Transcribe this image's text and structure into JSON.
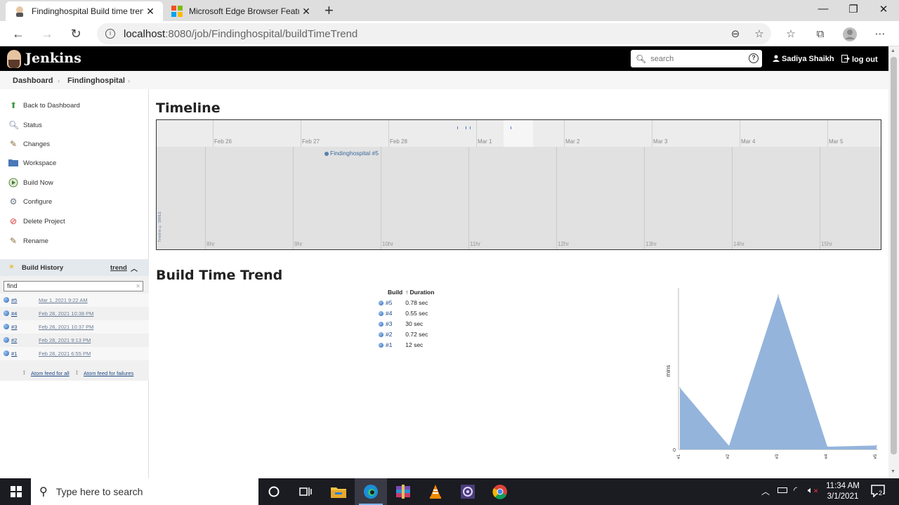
{
  "browser": {
    "tabs": [
      {
        "title": "Findinghospital Build time trend",
        "active": true
      },
      {
        "title": "Microsoft Edge Browser Features",
        "active": false
      }
    ],
    "url_host": "localhost",
    "url_rest": ":8080/job/Findinghospital/buildTimeTrend"
  },
  "jenkins": {
    "title": "Jenkins",
    "search_placeholder": "search",
    "user": "Sadiya Shaikh",
    "logout": "log out"
  },
  "breadcrumb": [
    "Dashboard",
    "Findinghospital"
  ],
  "sidebar": {
    "tasks": [
      {
        "label": "Back to Dashboard",
        "icon": "up-arrow-icon"
      },
      {
        "label": "Status",
        "icon": "magnifier-icon"
      },
      {
        "label": "Changes",
        "icon": "notepad-icon"
      },
      {
        "label": "Workspace",
        "icon": "folder-icon"
      },
      {
        "label": "Build Now",
        "icon": "clock-play-icon"
      },
      {
        "label": "Configure",
        "icon": "gear-icon"
      },
      {
        "label": "Delete Project",
        "icon": "no-entry-icon"
      },
      {
        "label": "Rename",
        "icon": "notepad-icon"
      }
    ],
    "build_history": {
      "title": "Build History",
      "trend_link": "trend",
      "find_value": "find",
      "builds": [
        {
          "num": "#5",
          "date": "Mar 1, 2021 9:22 AM"
        },
        {
          "num": "#4",
          "date": "Feb 28, 2021 10:38 PM"
        },
        {
          "num": "#3",
          "date": "Feb 28, 2021 10:37 PM"
        },
        {
          "num": "#2",
          "date": "Feb 28, 2021 9:13 PM"
        },
        {
          "num": "#1",
          "date": "Feb 28, 2021 6:55 PM"
        }
      ],
      "feed_all": "Atom feed for all",
      "feed_failures": "Atom feed for failures"
    }
  },
  "timeline": {
    "heading": "Timeline",
    "days": [
      "Feb 26",
      "Feb 27",
      "Feb 28",
      "Mar 1",
      "Mar 2",
      "Mar 3",
      "Mar 4",
      "Mar 5"
    ],
    "hours": [
      "8hr",
      "9hr",
      "10hr",
      "11hr",
      "12hr",
      "13hr",
      "14hr",
      "15hr"
    ],
    "event": "Findinghospital #5",
    "credit": "Timeline © SIMILE"
  },
  "trend": {
    "heading": "Build Time Trend",
    "col_build": "Build",
    "col_duration": "Duration",
    "sort_arrow": "↑",
    "rows": [
      {
        "build": "#5",
        "duration": "0.78 sec"
      },
      {
        "build": "#4",
        "duration": "0.55 sec"
      },
      {
        "build": "#3",
        "duration": "30 sec"
      },
      {
        "build": "#2",
        "duration": "0.72 sec"
      },
      {
        "build": "#1",
        "duration": "12 sec"
      }
    ]
  },
  "chart_data": {
    "type": "area",
    "x": [
      "#1",
      "#2",
      "#3",
      "#4",
      "#5"
    ],
    "series": [
      {
        "values": [
          12,
          0.72,
          30,
          0.55,
          0.78
        ]
      }
    ],
    "ylabel": "mins",
    "yticks": [
      "0"
    ],
    "xtick_labels": [
      "#1",
      "#2",
      "#3",
      "#4",
      "#5"
    ],
    "color": "#94b4dc"
  },
  "taskbar": {
    "search_placeholder": "Type here to search",
    "time": "11:34 AM",
    "date": "3/1/2021",
    "notifications": "2"
  }
}
